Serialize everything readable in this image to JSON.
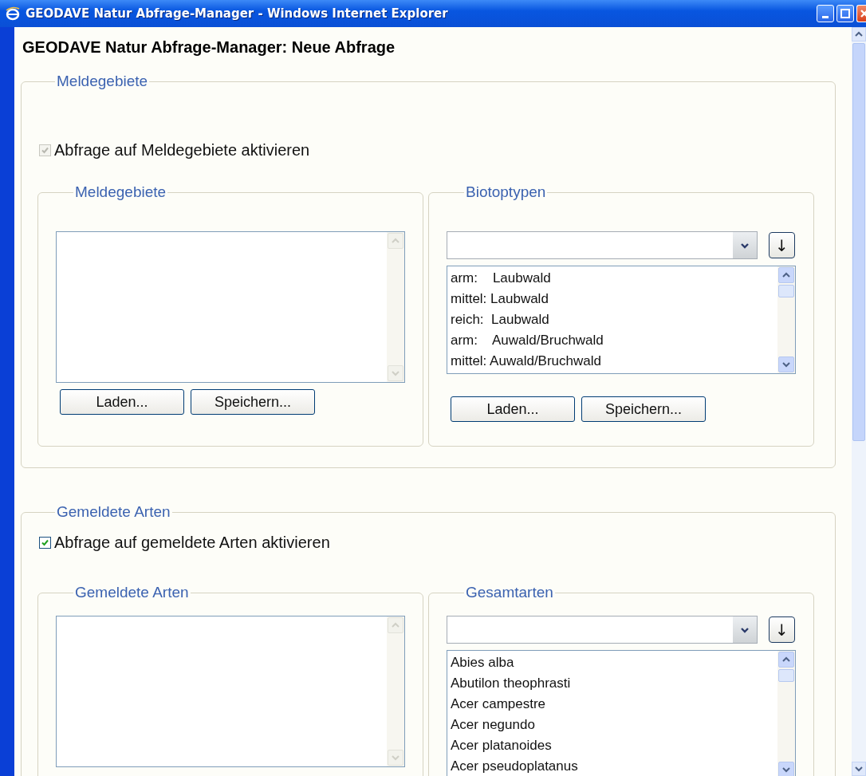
{
  "window": {
    "title": "GEODAVE Natur Abfrage-Manager - Windows Internet Explorer"
  },
  "page_title": "GEODAVE Natur Abfrage-Manager: Neue Abfrage",
  "sections": [
    {
      "legend": "Meldegebiete",
      "activation": {
        "label": "Abfrage auf Meldegebiete aktivieren",
        "checked": true,
        "disabled": true
      },
      "panels": [
        {
          "legend": "Meldegebiete",
          "kind": "list",
          "buttons": [
            "Laden...",
            "Speichern..."
          ]
        },
        {
          "legend": "Biotoptypen",
          "kind": "picker",
          "add_button": "↓",
          "items": [
            "arm:    Laubwald",
            "mittel: Laubwald",
            "reich:  Laubwald",
            "arm:    Auwald/Bruchwald",
            "mittel: Auwald/Bruchwald"
          ],
          "buttons": [
            "Laden...",
            "Speichern..."
          ]
        }
      ]
    },
    {
      "legend": "Gemeldete Arten",
      "activation": {
        "label": "Abfrage auf gemeldete Arten aktivieren",
        "checked": true,
        "disabled": false
      },
      "panels": [
        {
          "legend": "Gemeldete Arten",
          "kind": "list"
        },
        {
          "legend": "Gesamtarten",
          "kind": "picker",
          "add_button": "↓",
          "items": [
            "Abies alba",
            "Abutilon theophrasti",
            "Acer campestre",
            "Acer negundo",
            "Acer platanoides",
            "Acer pseudoplatanus"
          ]
        }
      ]
    }
  ]
}
